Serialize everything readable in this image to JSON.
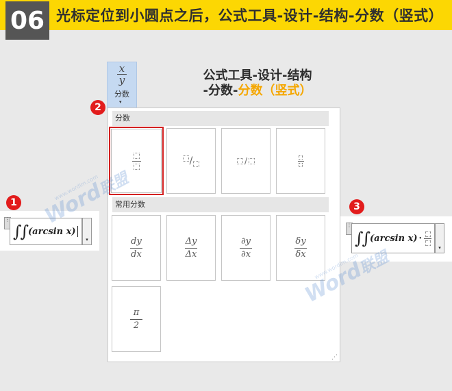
{
  "header": {
    "step": "06",
    "title": "光标定位到小圆点之后，公式工具-设计-结构-分数（竖式）"
  },
  "ribbon": {
    "fraction_button": {
      "numerator": "x",
      "denominator": "y",
      "label": "分数",
      "dropdown_glyph": "▾"
    }
  },
  "callout": {
    "line1": "公式工具-设计-结构",
    "line2_prefix": "-分数-",
    "line2_highlight": "分数（竖式）"
  },
  "badges": {
    "one": "1",
    "two": "2",
    "three": "3"
  },
  "gallery": {
    "section_fraction": "分数",
    "section_common": "常用分数",
    "fraction_tiles": [
      {
        "name": "stacked-fraction",
        "glyph": ""
      },
      {
        "name": "skewed-fraction",
        "glyph": "/"
      },
      {
        "name": "linear-fraction",
        "glyph": "/"
      },
      {
        "name": "small-fraction",
        "glyph": ""
      }
    ],
    "common_tiles": [
      {
        "num": "dy",
        "den": "dx"
      },
      {
        "num": "Δy",
        "den": "Δx"
      },
      {
        "num": "∂y",
        "den": "∂x"
      },
      {
        "num": "δy",
        "den": "δx"
      },
      {
        "num": "π",
        "den": "2"
      }
    ],
    "resize_glyph": "⋰"
  },
  "equations": {
    "before": {
      "integrals": "∫∫",
      "expr": "(arcsin x)",
      "dropdown_glyph": "▾"
    },
    "after": {
      "integrals": "∫∫",
      "expr": "(arcsin x)",
      "dot": "·",
      "dropdown_glyph": "▾"
    }
  },
  "watermark": {
    "brand": "Word",
    "cn": "联盟",
    "url": "www.wordlm.com"
  },
  "colors": {
    "banner": "#fcd703",
    "badge": "#e21c1c",
    "selection": "#d32020",
    "highlight": "#f5a700",
    "ribbon_active": "#c5d9f1"
  }
}
